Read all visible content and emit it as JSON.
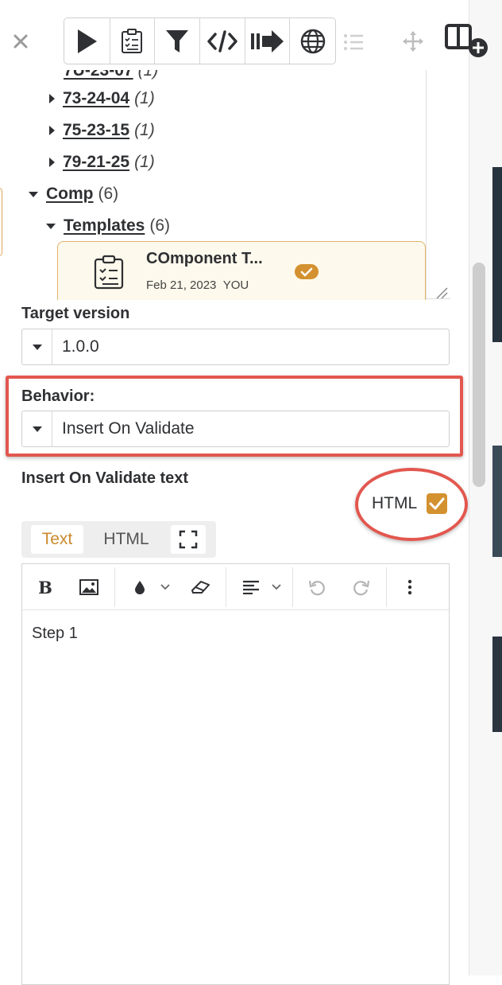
{
  "tree": {
    "rows": [
      {
        "label": "73-24-04",
        "count": "(1)"
      },
      {
        "label": "75-23-15",
        "count": "(1)"
      },
      {
        "label": "79-21-25",
        "count": "(1)"
      },
      {
        "label": "Comp",
        "count": "(6)"
      },
      {
        "label": "Templates",
        "count": "(6)"
      }
    ]
  },
  "template_card": {
    "title": "COmponent T...",
    "date": "Feb 21, 2023",
    "owner": "YOU"
  },
  "target_version": {
    "label": "Target version",
    "value": "1.0.0"
  },
  "behavior": {
    "label": "Behavior:",
    "value": "Insert On Validate"
  },
  "insert_text": {
    "label": "Insert On Validate text",
    "html_toggle_label": "HTML",
    "html_checked": true
  },
  "editor_tabs": {
    "text": "Text",
    "html": "HTML"
  },
  "editor": {
    "content": "Step 1"
  },
  "colors": {
    "accent": "#d4912f",
    "highlight": "#e2574f"
  }
}
